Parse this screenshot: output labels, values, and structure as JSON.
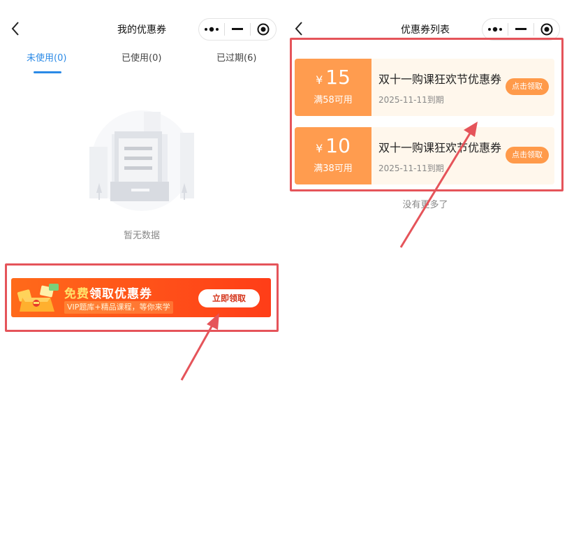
{
  "left": {
    "nav": {
      "title": "我的优惠券"
    },
    "tabs": [
      {
        "label": "未使用(0)",
        "active": true
      },
      {
        "label": "已使用(0)",
        "active": false
      },
      {
        "label": "已过期(6)",
        "active": false
      }
    ],
    "empty_text": "暂无数据",
    "promo": {
      "title_highlight": "免费",
      "title_rest": "领取优惠券",
      "subtitle": "VIP题库+精品课程，等你来学",
      "button": "立即领取"
    }
  },
  "right": {
    "nav": {
      "title": "优惠券列表"
    },
    "coupons": [
      {
        "currency": "¥",
        "amount": "15",
        "condition": "满58可用",
        "title": "双十一购课狂欢节优惠券",
        "expiry": "2025-11-11到期",
        "button": "点击领取"
      },
      {
        "currency": "¥",
        "amount": "10",
        "condition": "满38可用",
        "title": "双十一购课狂欢节优惠券",
        "expiry": "2025-11-11到期",
        "button": "点击领取"
      }
    ],
    "no_more": "没有更多了"
  },
  "colors": {
    "tab_active": "#2b8ae6",
    "promo_start": "#ff6a1a",
    "promo_end": "#ff3d18",
    "coupon_orange": "#ff9c4f",
    "highlight_box": "#e5545a"
  },
  "icons": [
    "back-arrow-icon",
    "more-dots-icon",
    "minimize-icon",
    "record-target-icon"
  ]
}
